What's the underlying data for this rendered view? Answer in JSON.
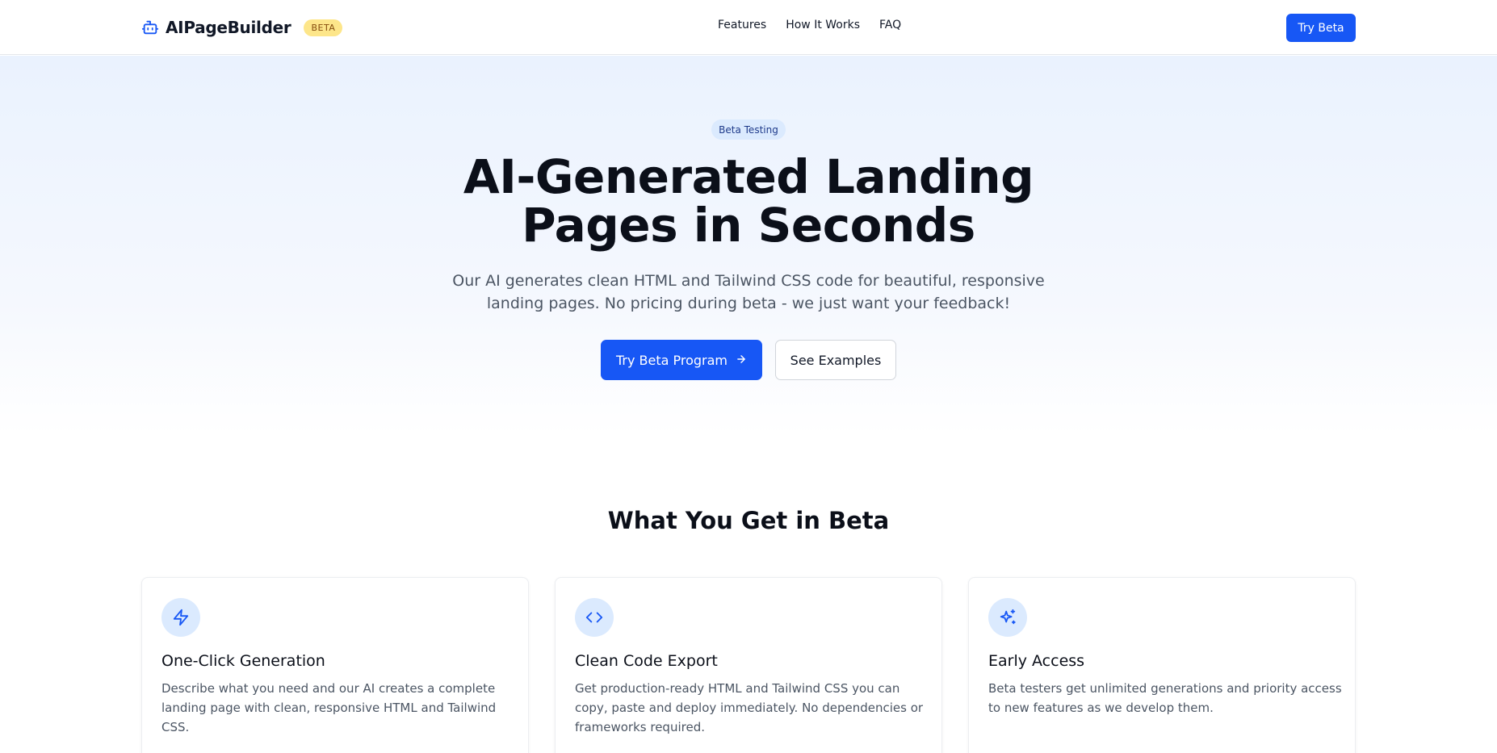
{
  "navbar": {
    "brand": "AIPageBuilder",
    "brand_icon": "robot-icon",
    "beta_label": "BETA",
    "links": [
      "Features",
      "How It Works",
      "FAQ"
    ],
    "cta_label": "Try Beta"
  },
  "hero": {
    "badge": "Beta Testing",
    "title": "AI-Generated Landing Pages in Seconds",
    "subtitle": "Our AI generates clean HTML and Tailwind CSS code for beautiful, responsive landing pages. No pricing during beta - we just want your feedback!",
    "primary_button": "Try Beta Program",
    "primary_button_icon": "arrow-right-icon",
    "secondary_button": "See Examples"
  },
  "features": {
    "title": "What You Get in Beta",
    "cards": [
      {
        "icon": "lightning-icon",
        "title": "One-Click Generation",
        "description": "Describe what you need and our AI creates a complete landing page with clean, responsive HTML and Tailwind CSS."
      },
      {
        "icon": "code-icon",
        "title": "Clean Code Export",
        "description": "Get production-ready HTML and Tailwind CSS you can copy, paste and deploy immediately. No dependencies or frameworks required."
      },
      {
        "icon": "sparkles-icon",
        "title": "Early Access",
        "description": "Beta testers get unlimited generations and priority access to new features as we develop them."
      }
    ]
  },
  "colors": {
    "primary": "#1757f5",
    "badge_bg": "#dbeafe",
    "beta_pill_bg": "#fde68a",
    "hero_bg_top": "#eaf2fe"
  }
}
